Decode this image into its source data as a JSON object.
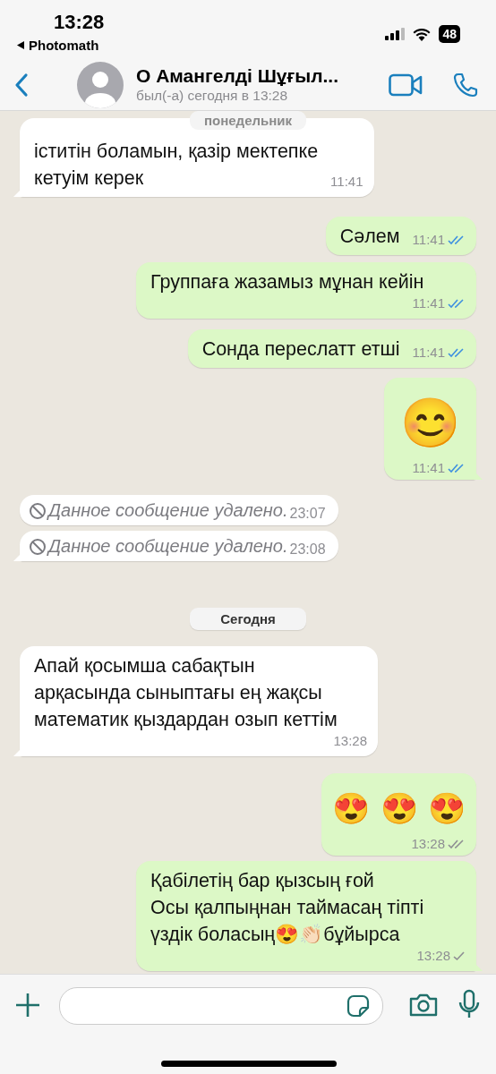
{
  "status_bar": {
    "time": "13:28",
    "back_app": "Photomath",
    "battery": "48"
  },
  "header": {
    "name": "О Амангелді Шұғыл...",
    "last_seen": "был(-а) сегодня в 13:28"
  },
  "sticky_date": {
    "label": "понедельник"
  },
  "messages": [
    {
      "kind": "text",
      "outgoing": false,
      "text": "іститін боламын, қазір мектепке\nкетуім керек",
      "time": "11:41",
      "tail": true
    },
    {
      "kind": "text",
      "outgoing": true,
      "text": "Сәлем",
      "time": "11:41",
      "delivered": true,
      "read": true,
      "tail": false
    },
    {
      "kind": "text",
      "outgoing": true,
      "text": "Группаға жазамыз мұнан кейін",
      "time": "11:41",
      "delivered": true,
      "read": true,
      "tail": false
    },
    {
      "kind": "text",
      "outgoing": true,
      "text": "Сонда переслатт етші",
      "time": "11:41",
      "delivered": true,
      "read": true,
      "tail": false
    },
    {
      "kind": "emoji",
      "outgoing": true,
      "text": "😊",
      "time": "11:41",
      "delivered": true,
      "read": true,
      "tail": true
    },
    {
      "kind": "deleted",
      "outgoing": false,
      "text": "Данное сообщение удалено.",
      "time": "23:07",
      "tail": false
    },
    {
      "kind": "deleted",
      "outgoing": false,
      "text": "Данное сообщение удалено.",
      "time": "23:08",
      "tail": true
    },
    {
      "kind": "date",
      "text": "Сегодня"
    },
    {
      "kind": "text",
      "outgoing": false,
      "text": "Апай қосымша сабақтын\nарқасында сыныптағы ең жақсы\nматематик қыздардан озып кеттім",
      "time": "13:28",
      "tail": true
    },
    {
      "kind": "emoji",
      "outgoing": true,
      "text": "😍 😍 😍",
      "time": "13:28",
      "delivered": true,
      "read": false,
      "tail": false
    },
    {
      "kind": "text",
      "outgoing": true,
      "text": "Қабілетің бар қызсың ғой\nОсы қалпыңнан таймасаң тіпті\nүздік боласың😍👏🏻бұйырса",
      "time": "13:28",
      "delivered": false,
      "read": false,
      "tail": true
    }
  ]
}
